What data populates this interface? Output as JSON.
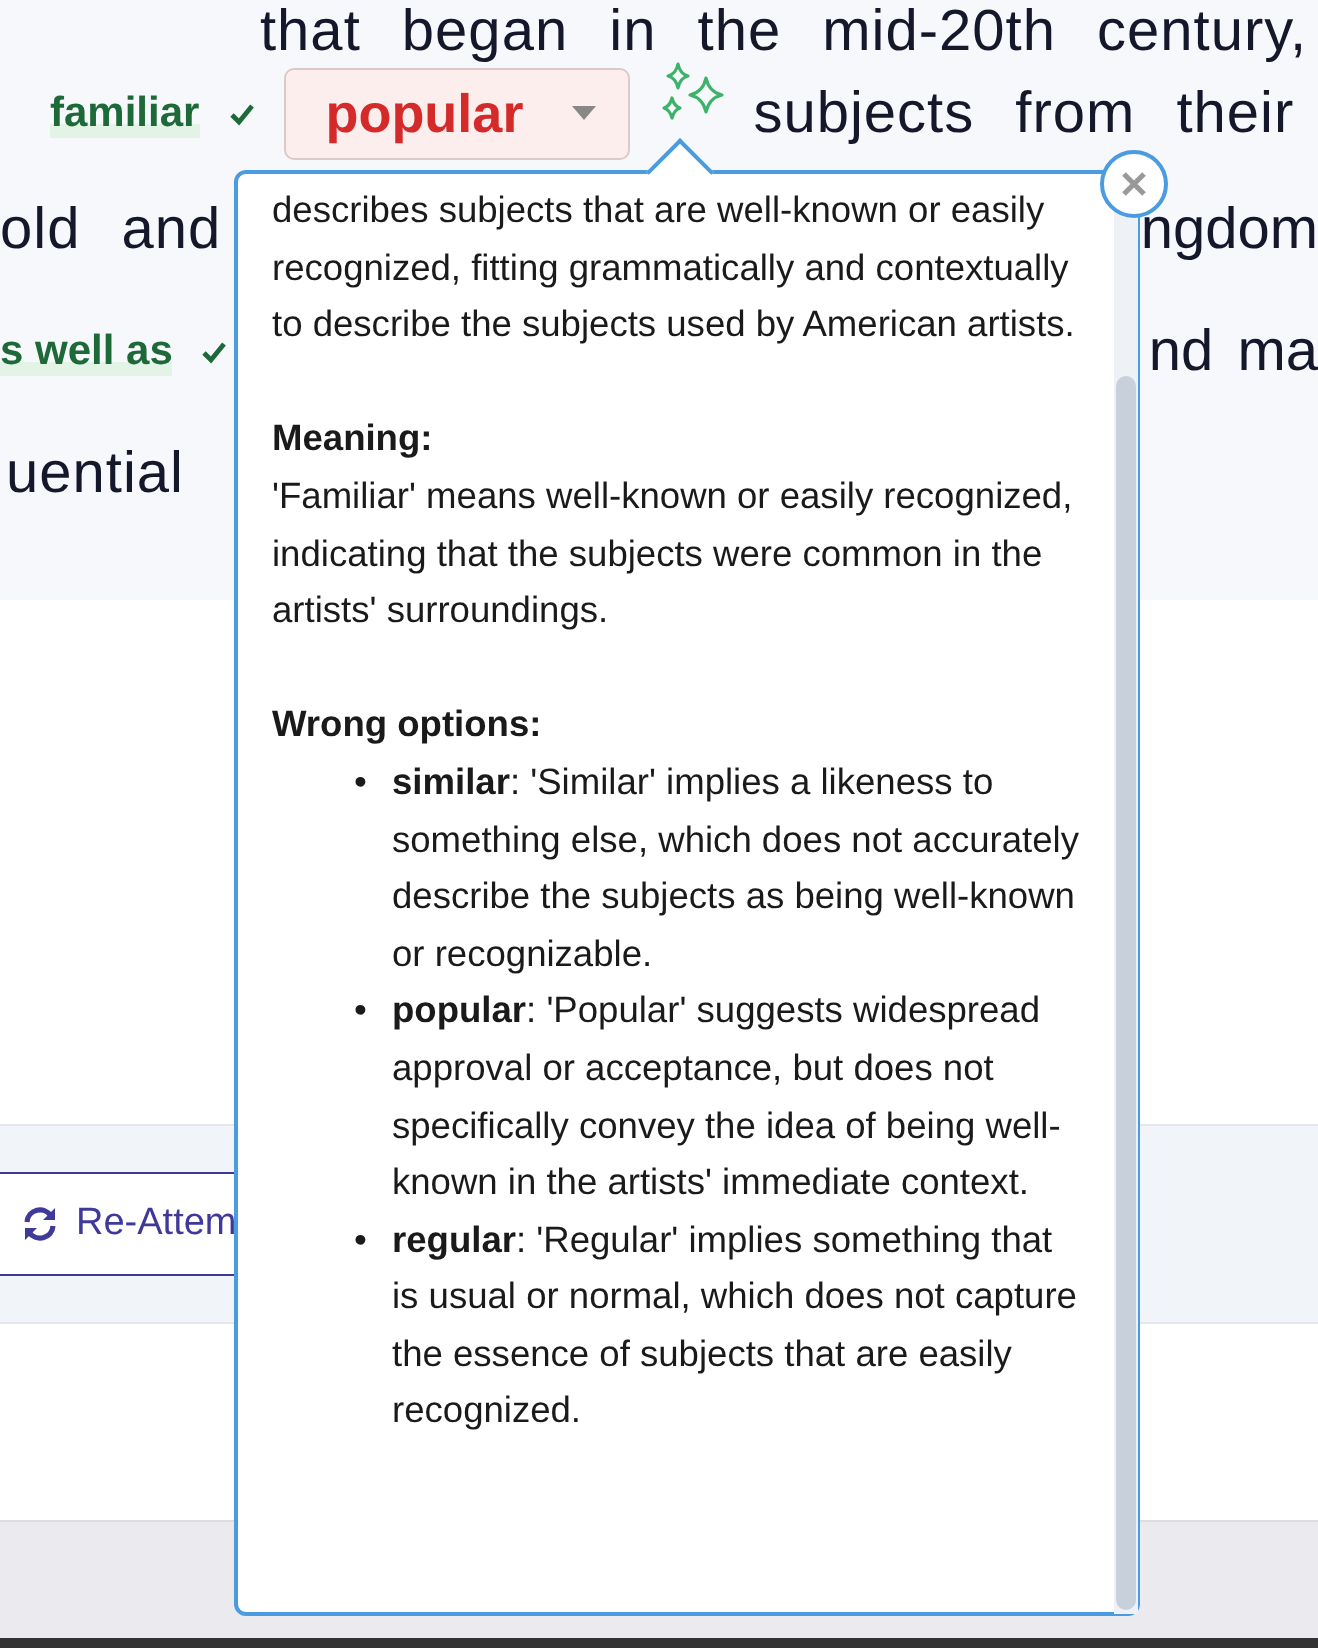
{
  "passage": {
    "lines": [
      {
        "left": [
          {
            "kind": "text",
            "text": "that began in the mid-20th century,"
          }
        ]
      },
      {
        "left": [
          {
            "kind": "answer",
            "text": "familiar",
            "correct": true
          },
          {
            "kind": "dropdown",
            "value": "popular",
            "correct": false
          },
          {
            "kind": "sparkle"
          },
          {
            "kind": "text",
            "text": "subjects from their"
          }
        ]
      },
      {
        "left": [
          {
            "kind": "text",
            "text": "old and"
          }
        ],
        "right": [
          {
            "kind": "text",
            "text": "ngdom"
          }
        ]
      },
      {
        "left": [
          {
            "kind": "answer",
            "text": "s well as",
            "correct": true
          }
        ],
        "right": [
          {
            "kind": "text",
            "text": "nd ma"
          }
        ]
      },
      {
        "left": [
          {
            "kind": "text",
            "text": "uential"
          }
        ]
      }
    ]
  },
  "retry_button": {
    "label": "Re-Attem"
  },
  "explanation": {
    "intro": "describes subjects that are well-known or easily recognized, fitting grammatically and contextually to describe the subjects used by American artists.",
    "sections": [
      {
        "heading": "Meaning:",
        "body": "'Familiar' means well-known or easily recognized, indicating that the subjects were common in the artists' surroundings."
      },
      {
        "heading": "Wrong options:",
        "items": [
          {
            "marker": "•",
            "text": "**similar**: 'Similar' implies a likeness to something else, which does not accurately describe the subjects as being well-known or recognizable."
          },
          {
            "marker": "•",
            "text": "**popular**: 'Popular' suggests widespread approval or acceptance, but does not specifically convey the idea of being well-known in the artists' immediate context."
          },
          {
            "marker": "•",
            "text": "**regular**: 'Regular' implies something that is usual or normal, which does not capture the essence of subjects that are easily recognized."
          }
        ]
      }
    ]
  }
}
